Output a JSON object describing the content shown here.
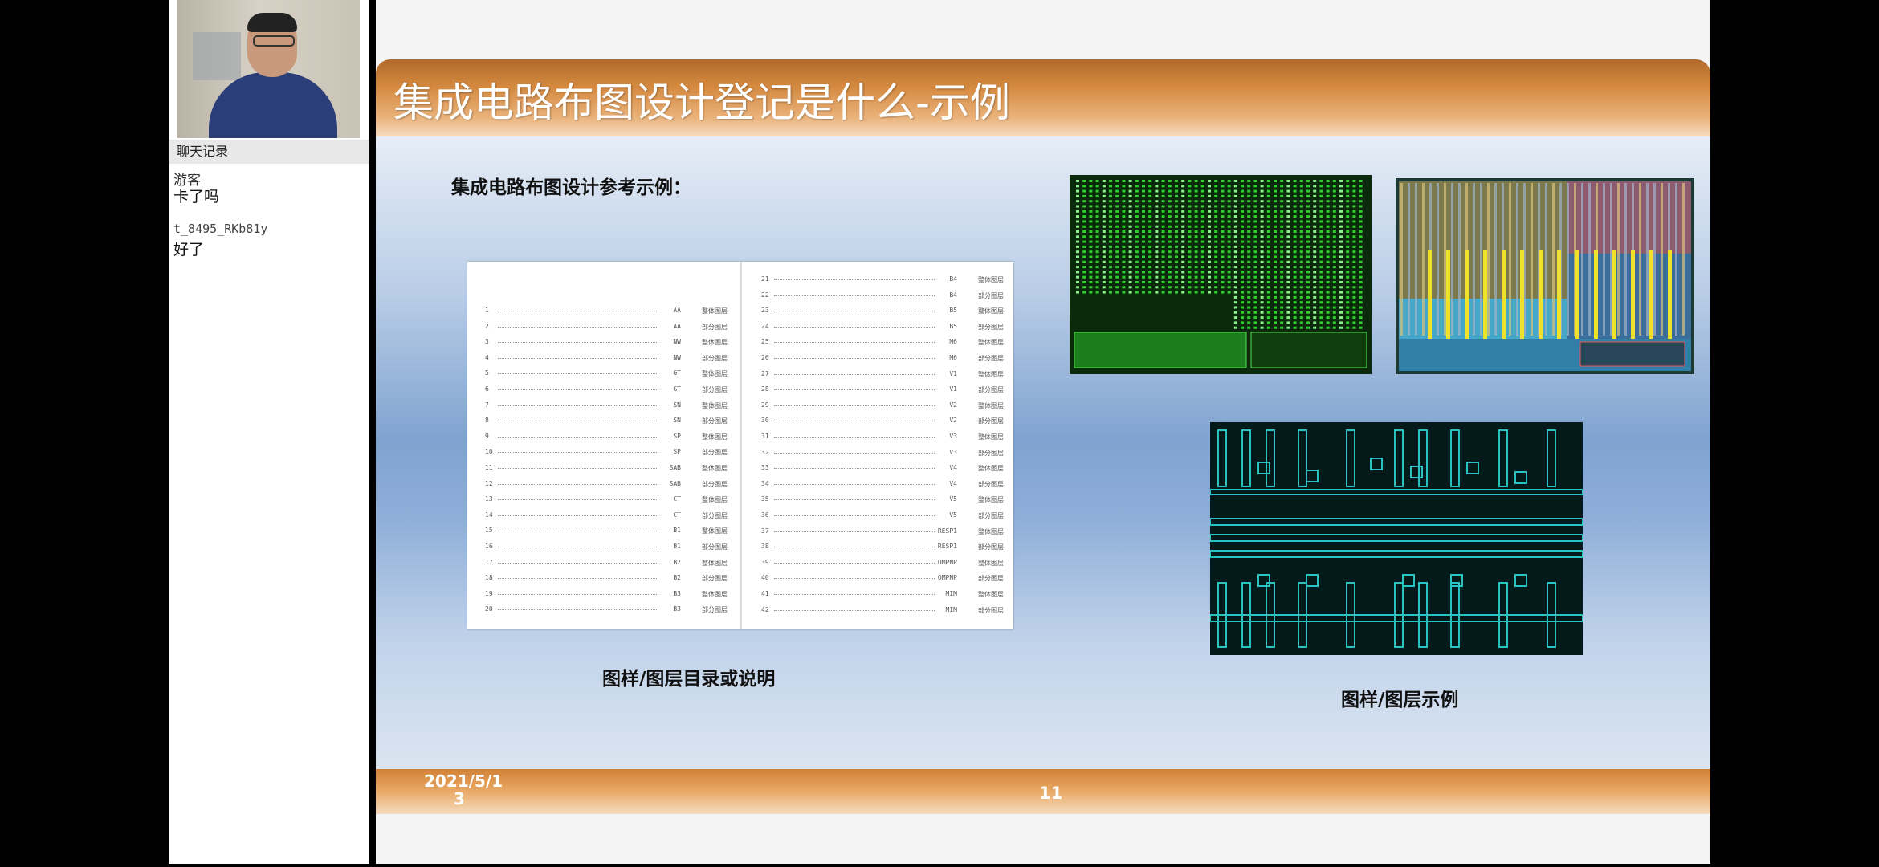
{
  "chat": {
    "header": "聊天记录",
    "messages": [
      {
        "name": "游客",
        "text": "卡了吗"
      },
      {
        "name": "t_8495_RKb81y",
        "text": "好了"
      }
    ]
  },
  "slide": {
    "title": "集成电路布图设计登记是什么-示例",
    "subtitle": "集成电路布图设计参考示例：",
    "caption_left": "图样/图层目录或说明",
    "caption_right": "图样/图层示例",
    "footer_date_line1": "2021/5/1",
    "footer_date_line2": "3",
    "page_number": "11",
    "left_list": [
      {
        "num": "1",
        "code": "AA",
        "desc": "整体图层"
      },
      {
        "num": "2",
        "code": "AA",
        "desc": "部分图层"
      },
      {
        "num": "3",
        "code": "NW",
        "desc": "整体图层"
      },
      {
        "num": "4",
        "code": "NW",
        "desc": "部分图层"
      },
      {
        "num": "5",
        "code": "GT",
        "desc": "整体图层"
      },
      {
        "num": "6",
        "code": "GT",
        "desc": "部分图层"
      },
      {
        "num": "7",
        "code": "SN",
        "desc": "整体图层"
      },
      {
        "num": "8",
        "code": "SN",
        "desc": "部分图层"
      },
      {
        "num": "9",
        "code": "SP",
        "desc": "整体图层"
      },
      {
        "num": "10",
        "code": "SP",
        "desc": "部分图层"
      },
      {
        "num": "11",
        "code": "SAB",
        "desc": "整体图层"
      },
      {
        "num": "12",
        "code": "SAB",
        "desc": "部分图层"
      },
      {
        "num": "13",
        "code": "CT",
        "desc": "整体图层"
      },
      {
        "num": "14",
        "code": "CT",
        "desc": "部分图层"
      },
      {
        "num": "15",
        "code": "B1",
        "desc": "整体图层"
      },
      {
        "num": "16",
        "code": "B1",
        "desc": "部分图层"
      },
      {
        "num": "17",
        "code": "B2",
        "desc": "整体图层"
      },
      {
        "num": "18",
        "code": "B2",
        "desc": "部分图层"
      },
      {
        "num": "19",
        "code": "B3",
        "desc": "整体图层"
      },
      {
        "num": "20",
        "code": "B3",
        "desc": "部分图层"
      }
    ],
    "right_list": [
      {
        "num": "21",
        "code": "B4",
        "desc": "整体图层"
      },
      {
        "num": "22",
        "code": "B4",
        "desc": "部分图层"
      },
      {
        "num": "23",
        "code": "B5",
        "desc": "整体图层"
      },
      {
        "num": "24",
        "code": "B5",
        "desc": "部分图层"
      },
      {
        "num": "25",
        "code": "M6",
        "desc": "整体图层"
      },
      {
        "num": "26",
        "code": "M6",
        "desc": "部分图层"
      },
      {
        "num": "27",
        "code": "V1",
        "desc": "整体图层"
      },
      {
        "num": "28",
        "code": "V1",
        "desc": "部分图层"
      },
      {
        "num": "29",
        "code": "V2",
        "desc": "整体图层"
      },
      {
        "num": "30",
        "code": "V2",
        "desc": "部分图层"
      },
      {
        "num": "31",
        "code": "V3",
        "desc": "整体图层"
      },
      {
        "num": "32",
        "code": "V3",
        "desc": "部分图层"
      },
      {
        "num": "33",
        "code": "V4",
        "desc": "整体图层"
      },
      {
        "num": "34",
        "code": "V4",
        "desc": "部分图层"
      },
      {
        "num": "35",
        "code": "V5",
        "desc": "整体图层"
      },
      {
        "num": "36",
        "code": "V5",
        "desc": "部分图层"
      },
      {
        "num": "37",
        "code": "RESP1",
        "desc": "整体图层"
      },
      {
        "num": "38",
        "code": "RESP1",
        "desc": "部分图层"
      },
      {
        "num": "39",
        "code": "OMPNP",
        "desc": "整体图层"
      },
      {
        "num": "40",
        "code": "OMPNP",
        "desc": "部分图层"
      },
      {
        "num": "41",
        "code": "MIM",
        "desc": "整体图层"
      },
      {
        "num": "42",
        "code": "MIM",
        "desc": "部分图层"
      }
    ]
  },
  "colors": {
    "title_bar": "#d4893f",
    "slide_gradient_mid": "#7fa3d0",
    "layout_green": "#2fd12f",
    "layout_cyan": "#1fb5b5"
  }
}
